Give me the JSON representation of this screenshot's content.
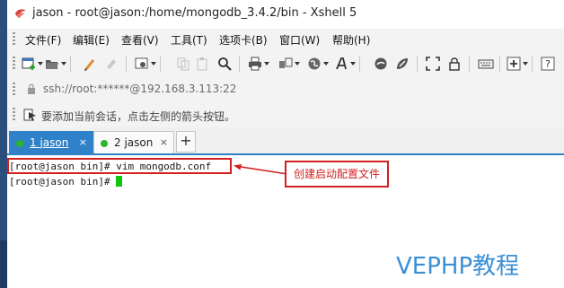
{
  "window": {
    "title": "jason - root@jason:/home/mongodb_3.4.2/bin - Xshell 5"
  },
  "menu": {
    "items": [
      "文件(F)",
      "编辑(E)",
      "查看(V)",
      "工具(T)",
      "选项卡(B)",
      "窗口(W)",
      "帮助(H)"
    ]
  },
  "toolbar": {
    "icons": [
      "new-session-icon",
      "open-folder-icon",
      "pen-icon",
      "eraser-icon",
      "properties-icon",
      "copy-icon",
      "paste-icon",
      "find-icon",
      "print-icon",
      "transfer-icon",
      "globe-icon",
      "font-icon",
      "xftp-icon",
      "xmanager-icon",
      "fullscreen-icon",
      "lock-icon",
      "keyboard-icon",
      "add-icon",
      "help-icon"
    ]
  },
  "address": {
    "value": "ssh://root:******@192.168.3.113:22"
  },
  "hint": {
    "text": "要添加当前会话，点击左侧的箭头按钮。"
  },
  "tabs": [
    {
      "label": "1 jason",
      "active": true,
      "status_color": "#2ab52a"
    },
    {
      "label": "2 jason",
      "active": false,
      "status_color": "#2ab52a"
    }
  ],
  "tab_add_label": "+",
  "tab_close_glyph": "×",
  "terminal": {
    "lines": [
      "[root@jason bin]# vim mongodb.conf",
      "[root@jason bin]# "
    ]
  },
  "annotation": {
    "callout": "创建启动配置文件",
    "color": "#d21f1f"
  },
  "watermark": "VEPHP教程",
  "colors": {
    "accent": "#2f81c8",
    "cursor": "#11c511",
    "watermark": "#3b8fd6"
  }
}
